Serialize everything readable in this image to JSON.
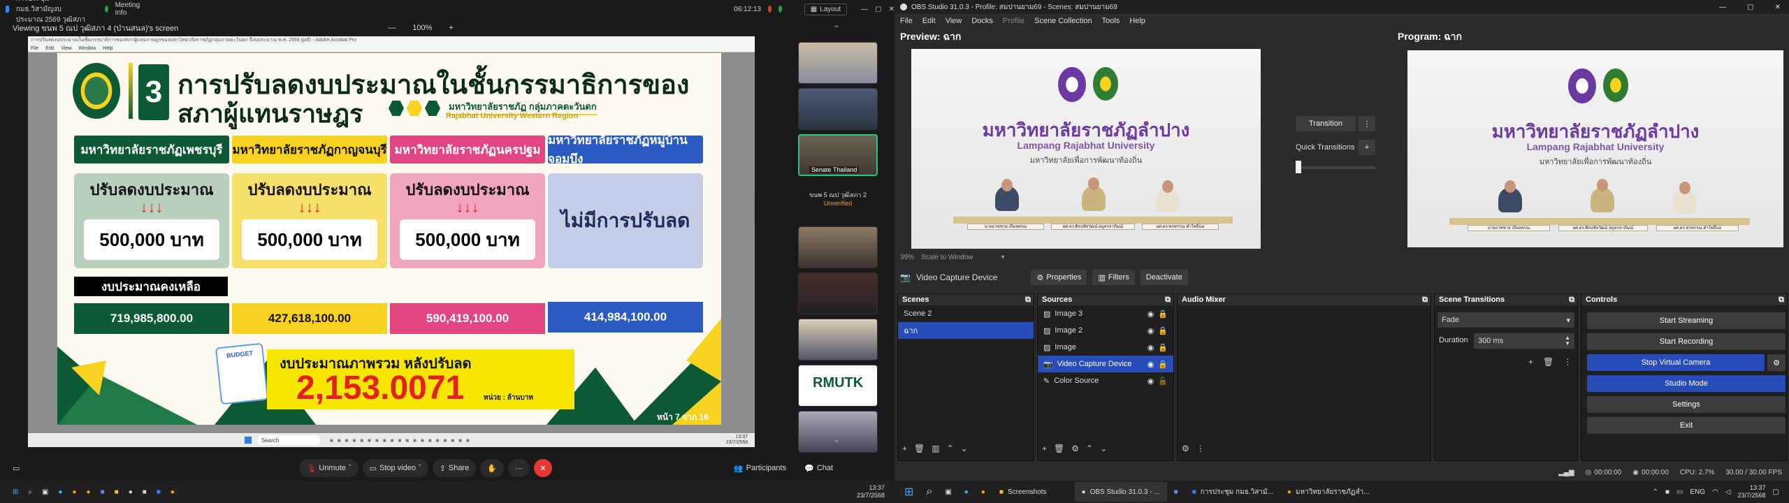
{
  "zoom": {
    "window_title": "การประชุม กมธ.วิสามัญงบประมาณ 2569 วุฒิสภา",
    "meeting_info": "Meeting Info",
    "clock_top": "06:12:13",
    "viewing_label": "Viewing ขนพ 5 ณป วุฒิสภา 4 (ป่านสนล)'s screen",
    "view_controls": {
      "zoom_level": "100%",
      "plus": "+",
      "minus": "—"
    },
    "layout_button": "Layout",
    "acrobat": {
      "title": "การปรับลดงบประมาณในชั้นกรรมาธิการของสภาผู้แทนราษฎรของมหาวิทยาลัยราชภัฏกลุ่มภาคตะวันตก ปีงบประมาณ พ.ศ. 2569 (pdf) - Adobe Acrobat Pro",
      "menu": [
        "File",
        "Edit",
        "View",
        "Window",
        "Help"
      ]
    },
    "slide": {
      "number": "3",
      "title_line1": "การปรับลดงบประมาณในชั้นกรรมาธิการของ",
      "title_line2": "สภาผู้แทนราษฎร",
      "group_th": "มหาวิทยาลัยราชภัฏ กลุ่มภาคตะวันตก",
      "group_en": "Rajabhat University Western Region",
      "universities": [
        {
          "name": "มหาวิทยาลัยราชภัฏเพชรบุรี",
          "color": "#0b5a34",
          "text": "#ffffff"
        },
        {
          "name": "มหาวิทยาลัยราชภัฏกาญจนบุรี",
          "color": "#f7d21f",
          "text": "#111111"
        },
        {
          "name": "มหาวิทยาลัยราชภัฏนครปฐม",
          "color": "#e2467f",
          "text": "#ffffff"
        },
        {
          "name": "มหาวิทยาลัยราชภัฏหมู่บ้านจอมบึง",
          "color": "#2a5bc2",
          "text": "#ffffff"
        }
      ],
      "cut_label": "ปรับลดงบประมาณ",
      "cut_amounts": [
        "500,000 บาท",
        "500,000 บาท",
        "500,000 บาท"
      ],
      "no_cut": "ไม่มีการปรับลด",
      "arrows": "↓↓↓",
      "remaining_label": "งบประมาณคงเหลือ",
      "remaining": [
        "719,985,800.00",
        "427,618,100.00",
        "590,419,100.00",
        "414,984,100.00"
      ],
      "total_label": "งบประมาณภาพรวม หลังปรับลด",
      "total_value": "2,153.0071",
      "total_unit": "หน่วย : ล้านบาท",
      "page": "หน้า 7 จาก 16",
      "budget_doc": "BUDGET"
    },
    "inner_taskbar": {
      "search": "Search",
      "time": "13:37",
      "date": "23/7/2568"
    },
    "thumbnails": {
      "senate_label": "Senate Thailand",
      "caption_name": "ขนพ 5 ณป วุฒิสภา 2",
      "caption_status": "Unverified",
      "rmutk": "RMUTK"
    },
    "bottom": {
      "unmute": "Unmute",
      "stop_video": "Stop video",
      "share": "Share",
      "participants": "Participants",
      "chat": "Chat"
    }
  },
  "taskbar_left": {
    "time": "13:37",
    "date": "23/7/2568"
  },
  "obs": {
    "window_title": "OBS Studio 31.0.3 - Profile: สมปานยาม69 - Scenes: สมปานยาม69",
    "menu": [
      "File",
      "Edit",
      "View",
      "Docks",
      "Profile",
      "Scene Collection",
      "Tools",
      "Help"
    ],
    "preview_label": "Preview: ฉาก",
    "program_label": "Program: ฉาก",
    "video": {
      "university_th": "มหาวิทยาลัยราชภัฏลำปาง",
      "university_en": "Lampang Rajabhat University",
      "motto": "มหาวิทยาลัยเพื่อการพัฒนาท้องถิ่น",
      "nameplates": [
        "นายธวชชาย เปียลพรณ",
        "ผศ.ดร.ศิลปชัยวัฒน์ สมุทรลาภิมณ์",
        "ผศ.ดร.พรพรรณ คำโพธิ์นอ"
      ]
    },
    "preview_zoom": "39%",
    "scale_to_window": "Scale to Window",
    "transition_button": "Transition",
    "quick_transitions": "Quick Transitions",
    "source_toolbar": {
      "source": "Video Capture Device",
      "properties": "Properties",
      "filters": "Filters",
      "deactivate": "Deactivate"
    },
    "scenes": {
      "title": "Scenes",
      "items": [
        "Scene 2",
        "ฉาก"
      ]
    },
    "sources": {
      "title": "Sources",
      "items": [
        "Image 3",
        "Image 2",
        "Image",
        "Video Capture Device",
        "Color Source"
      ]
    },
    "audio_mixer": {
      "title": "Audio Mixer"
    },
    "scene_transitions": {
      "title": "Scene Transitions",
      "type": "Fade",
      "duration_label": "Duration",
      "duration": "300 ms"
    },
    "controls": {
      "title": "Controls",
      "start_streaming": "Start Streaming",
      "start_recording": "Start Recording",
      "stop_virtual_camera": "Stop Virtual Camera",
      "studio_mode": "Studio Mode",
      "settings": "Settings",
      "exit": "Exit"
    },
    "status": {
      "stream_time": "00:00:00",
      "rec_time": "00:00:00",
      "cpu": "CPU: 2.7%",
      "fps": "30.00 / 30.00 FPS"
    }
  },
  "taskbar_right": {
    "apps": [
      "Screenshots",
      "OBS Studio 31.0.3 - ...",
      "การประชุม กมธ.วิสามั...",
      "มหาวิทยาลัยราชภัฏลำ..."
    ],
    "lang": "ENG",
    "time": "13:37",
    "date": "23/7/2568"
  }
}
